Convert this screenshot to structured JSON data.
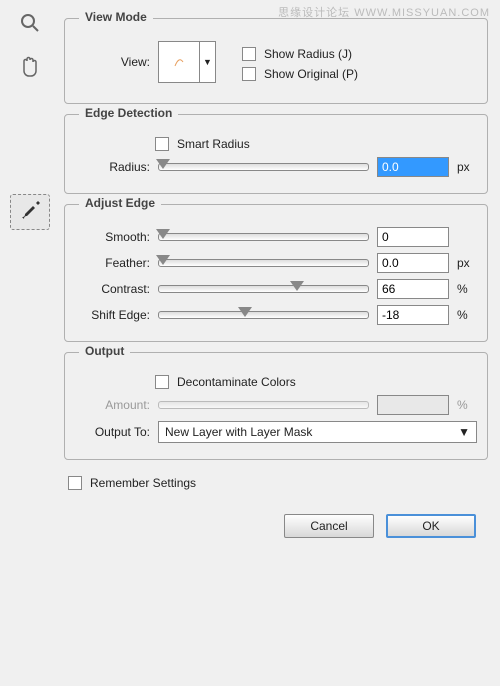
{
  "watermark_top": "思缘设计论坛  WWW.MISSYUAN.COM",
  "view_mode": {
    "legend": "View Mode",
    "label": "View:",
    "show_radius_label": "Show Radius (J)",
    "show_original_label": "Show Original (P)"
  },
  "edge_detection": {
    "legend": "Edge Detection",
    "smart_radius_label": "Smart Radius",
    "radius_label": "Radius:",
    "radius_value": "0.0",
    "radius_unit": "px"
  },
  "adjust_edge": {
    "legend": "Adjust Edge",
    "smooth_label": "Smooth:",
    "smooth_value": "0",
    "feather_label": "Feather:",
    "feather_value": "0.0",
    "feather_unit": "px",
    "contrast_label": "Contrast:",
    "contrast_value": "66",
    "contrast_unit": "%",
    "shift_edge_label": "Shift Edge:",
    "shift_edge_value": "-18",
    "shift_edge_unit": "%"
  },
  "output": {
    "legend": "Output",
    "decontaminate_label": "Decontaminate Colors",
    "amount_label": "Amount:",
    "amount_value": "",
    "amount_unit": "%",
    "output_to_label": "Output To:",
    "output_to_value": "New Layer with Layer Mask"
  },
  "remember_label": "Remember Settings",
  "buttons": {
    "cancel": "Cancel",
    "ok": "OK"
  }
}
